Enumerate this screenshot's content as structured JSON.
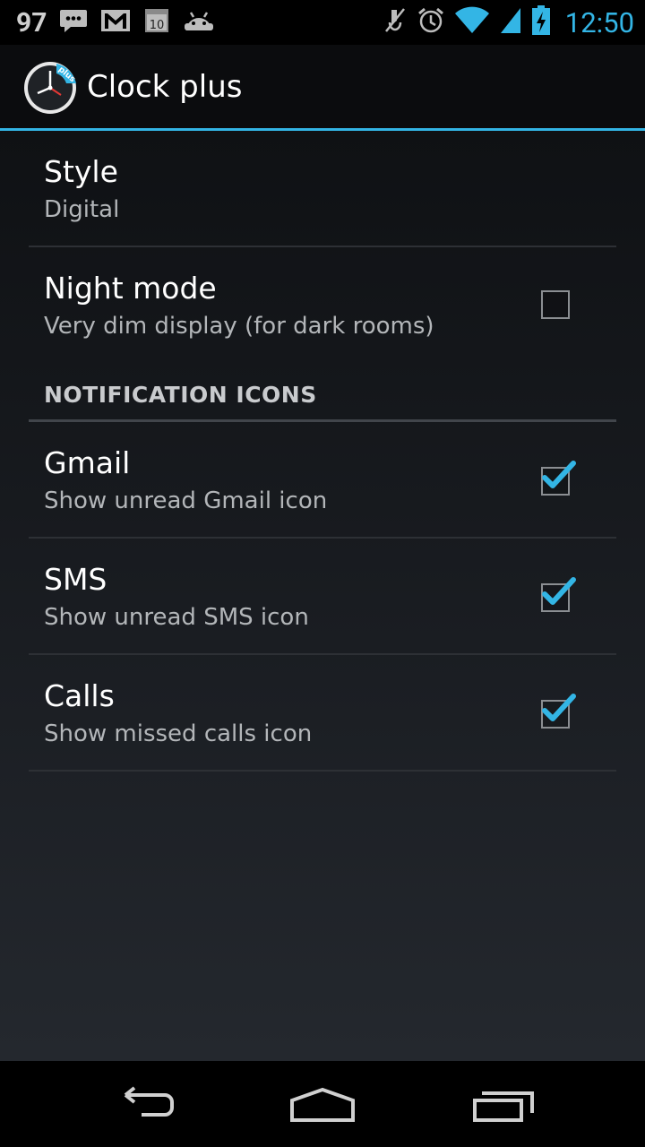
{
  "status_bar": {
    "notification_count": "97",
    "time": "12:50",
    "left_icons": [
      "talk-icon",
      "gmail-icon",
      "calendar-icon",
      "android-icon"
    ],
    "right_icons": [
      "mute-icon",
      "alarm-icon",
      "wifi-icon",
      "signal-icon",
      "battery-charging-icon"
    ],
    "calendar_day": "10",
    "accent_color": "#33b5e5"
  },
  "action_bar": {
    "title": "Clock plus",
    "icon_badge": "plus"
  },
  "preferences": {
    "style": {
      "title": "Style",
      "summary": "Digital"
    },
    "night_mode": {
      "title": "Night mode",
      "summary": "Very dim display (for dark rooms)",
      "checked": false
    },
    "section_header": "NOTIFICATION ICONS",
    "gmail": {
      "title": "Gmail",
      "summary": "Show unread Gmail icon",
      "checked": true
    },
    "sms": {
      "title": "SMS",
      "summary": "Show unread SMS icon",
      "checked": true
    },
    "calls": {
      "title": "Calls",
      "summary": "Show missed calls icon",
      "checked": true
    }
  },
  "nav_bar": {
    "buttons": [
      "back-icon",
      "home-icon",
      "recent-apps-icon"
    ]
  }
}
